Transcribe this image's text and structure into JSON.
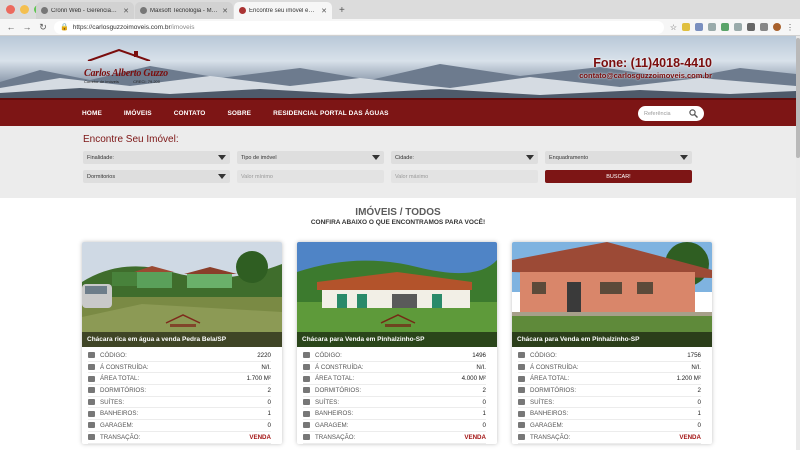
{
  "browser": {
    "tabs": [
      {
        "title": "Cronn Web - Gerenciador de",
        "active": false
      },
      {
        "title": "Maxsoft Tecnologia - Maxsoft",
        "active": false
      },
      {
        "title": "Encontre seu imóvel em Carlo",
        "active": true
      }
    ],
    "url_host": "https://carlosguzzoimoveis.com.br",
    "url_path": "/imoveis"
  },
  "header": {
    "logo_name": "Carlos Alberto Guzzo",
    "logo_sub_left": "Corretor de imóveis",
    "logo_sub_right": "CRECI: 79.200",
    "phone": "Fone: (11)4018-4410",
    "email": "contato@carlosguzzoimoveis.com.br"
  },
  "nav": {
    "items": [
      "HOME",
      "IMÓVEIS",
      "CONTATO",
      "SOBRE",
      "RESIDENCIAL PORTAL DAS ÁGUAS"
    ],
    "search_placeholder": "Referência"
  },
  "search": {
    "title": "Encontre Seu Imóvel:",
    "finalidade": "Finalidade:",
    "tipo": "Tipo de imóvel",
    "cidade": "Cidade:",
    "enquadramento": "Enquadramento",
    "dormitorios": "Dormitorios",
    "valor_min": "Valor mínimo",
    "valor_max": "Valor máximo",
    "button": "BUSCAR!"
  },
  "listing": {
    "title": "IMÓVEIS / TODOS",
    "subtitle": "CONFIRA ABAIXO O QUE ENCONTRAMOS PARA VOCÊ!",
    "labels": {
      "codigo": "CÓDIGO:",
      "construida": "Á CONSTRUÍDA:",
      "area_total": "ÁREA TOTAL:",
      "dormitorios": "DORMITÓRIOS:",
      "suites": "SUÍTES:",
      "banheiros": "BANHEIROS:",
      "garagem": "GARAGEM:",
      "transacao": "TRANSAÇÃO:"
    },
    "cards": [
      {
        "caption": "Chácara rica em água a venda Pedra Bela/SP",
        "codigo": "2220",
        "construida": "N/I.",
        "area_total": "1.700 M²",
        "dormitorios": "2",
        "suites": "0",
        "banheiros": "1",
        "garagem": "0",
        "transacao": "VENDA"
      },
      {
        "caption": "Chácara para Venda em Pinhalzinho-SP",
        "codigo": "1496",
        "construida": "N/I.",
        "area_total": "4.000 M²",
        "dormitorios": "2",
        "suites": "0",
        "banheiros": "1",
        "garagem": "0",
        "transacao": "VENDA"
      },
      {
        "caption": "Chácara para Venda em Pinhalzinho-SP",
        "codigo": "1756",
        "construida": "N/I.",
        "area_total": "1.200 M²",
        "dormitorios": "2",
        "suites": "0",
        "banheiros": "1",
        "garagem": "0",
        "transacao": "VENDA"
      }
    ]
  },
  "colors": {
    "brand": "#7d1515",
    "accent_text": "#a31515"
  }
}
